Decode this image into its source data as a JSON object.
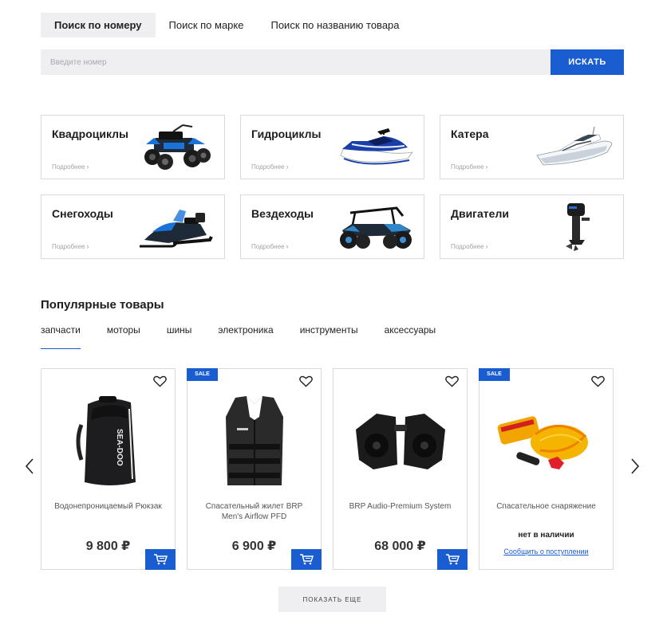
{
  "search": {
    "tabs": [
      {
        "label": "Поиск по номеру",
        "active": true
      },
      {
        "label": "Поиск по марке",
        "active": false
      },
      {
        "label": "Поиск по названию товара",
        "active": false
      }
    ],
    "placeholder": "Введите номер",
    "button_label": "ИСКАТЬ"
  },
  "categories": [
    {
      "title": "Квадроциклы",
      "more": "Подробнее",
      "icon": "atv-image"
    },
    {
      "title": "Гидроциклы",
      "more": "Подробнее",
      "icon": "jetski-image"
    },
    {
      "title": "Катера",
      "more": "Подробнее",
      "icon": "boat-image"
    },
    {
      "title": "Снегоходы",
      "more": "Подробнее",
      "icon": "snowmobile-image"
    },
    {
      "title": "Вездеходы",
      "more": "Подробнее",
      "icon": "utv-image"
    },
    {
      "title": "Двигатели",
      "more": "Подробнее",
      "icon": "outboard-motor-image"
    }
  ],
  "popular": {
    "title": "Популярные товары",
    "tabs": [
      {
        "label": "запчасти",
        "active": true
      },
      {
        "label": "моторы",
        "active": false
      },
      {
        "label": "шины",
        "active": false
      },
      {
        "label": "электроника",
        "active": false
      },
      {
        "label": "инструменты",
        "active": false
      },
      {
        "label": "аксессуары",
        "active": false
      }
    ],
    "products": [
      {
        "name": "Водонепроницаемый Рюкзак",
        "price": "9 800 ₽",
        "sale": false,
        "badge": ""
      },
      {
        "name": "Спасательный жилет BRP Men's Airflow PFD",
        "price": "6 900 ₽",
        "sale": true,
        "badge": "SALE"
      },
      {
        "name": "BRP Audio-Premium System",
        "price": "68 000 ₽",
        "sale": false,
        "badge": ""
      },
      {
        "name": "Спасательное снаряжение",
        "stock": "нет в наличии",
        "notify": "Сообщить о поступлении",
        "sale": true,
        "badge": "SALE"
      }
    ],
    "show_more": "ПОКАЗАТЬ ЕЩЕ"
  },
  "colors": {
    "accent": "#1a5dd0",
    "light_bg": "#efeff2",
    "border": "#d9d9de"
  }
}
